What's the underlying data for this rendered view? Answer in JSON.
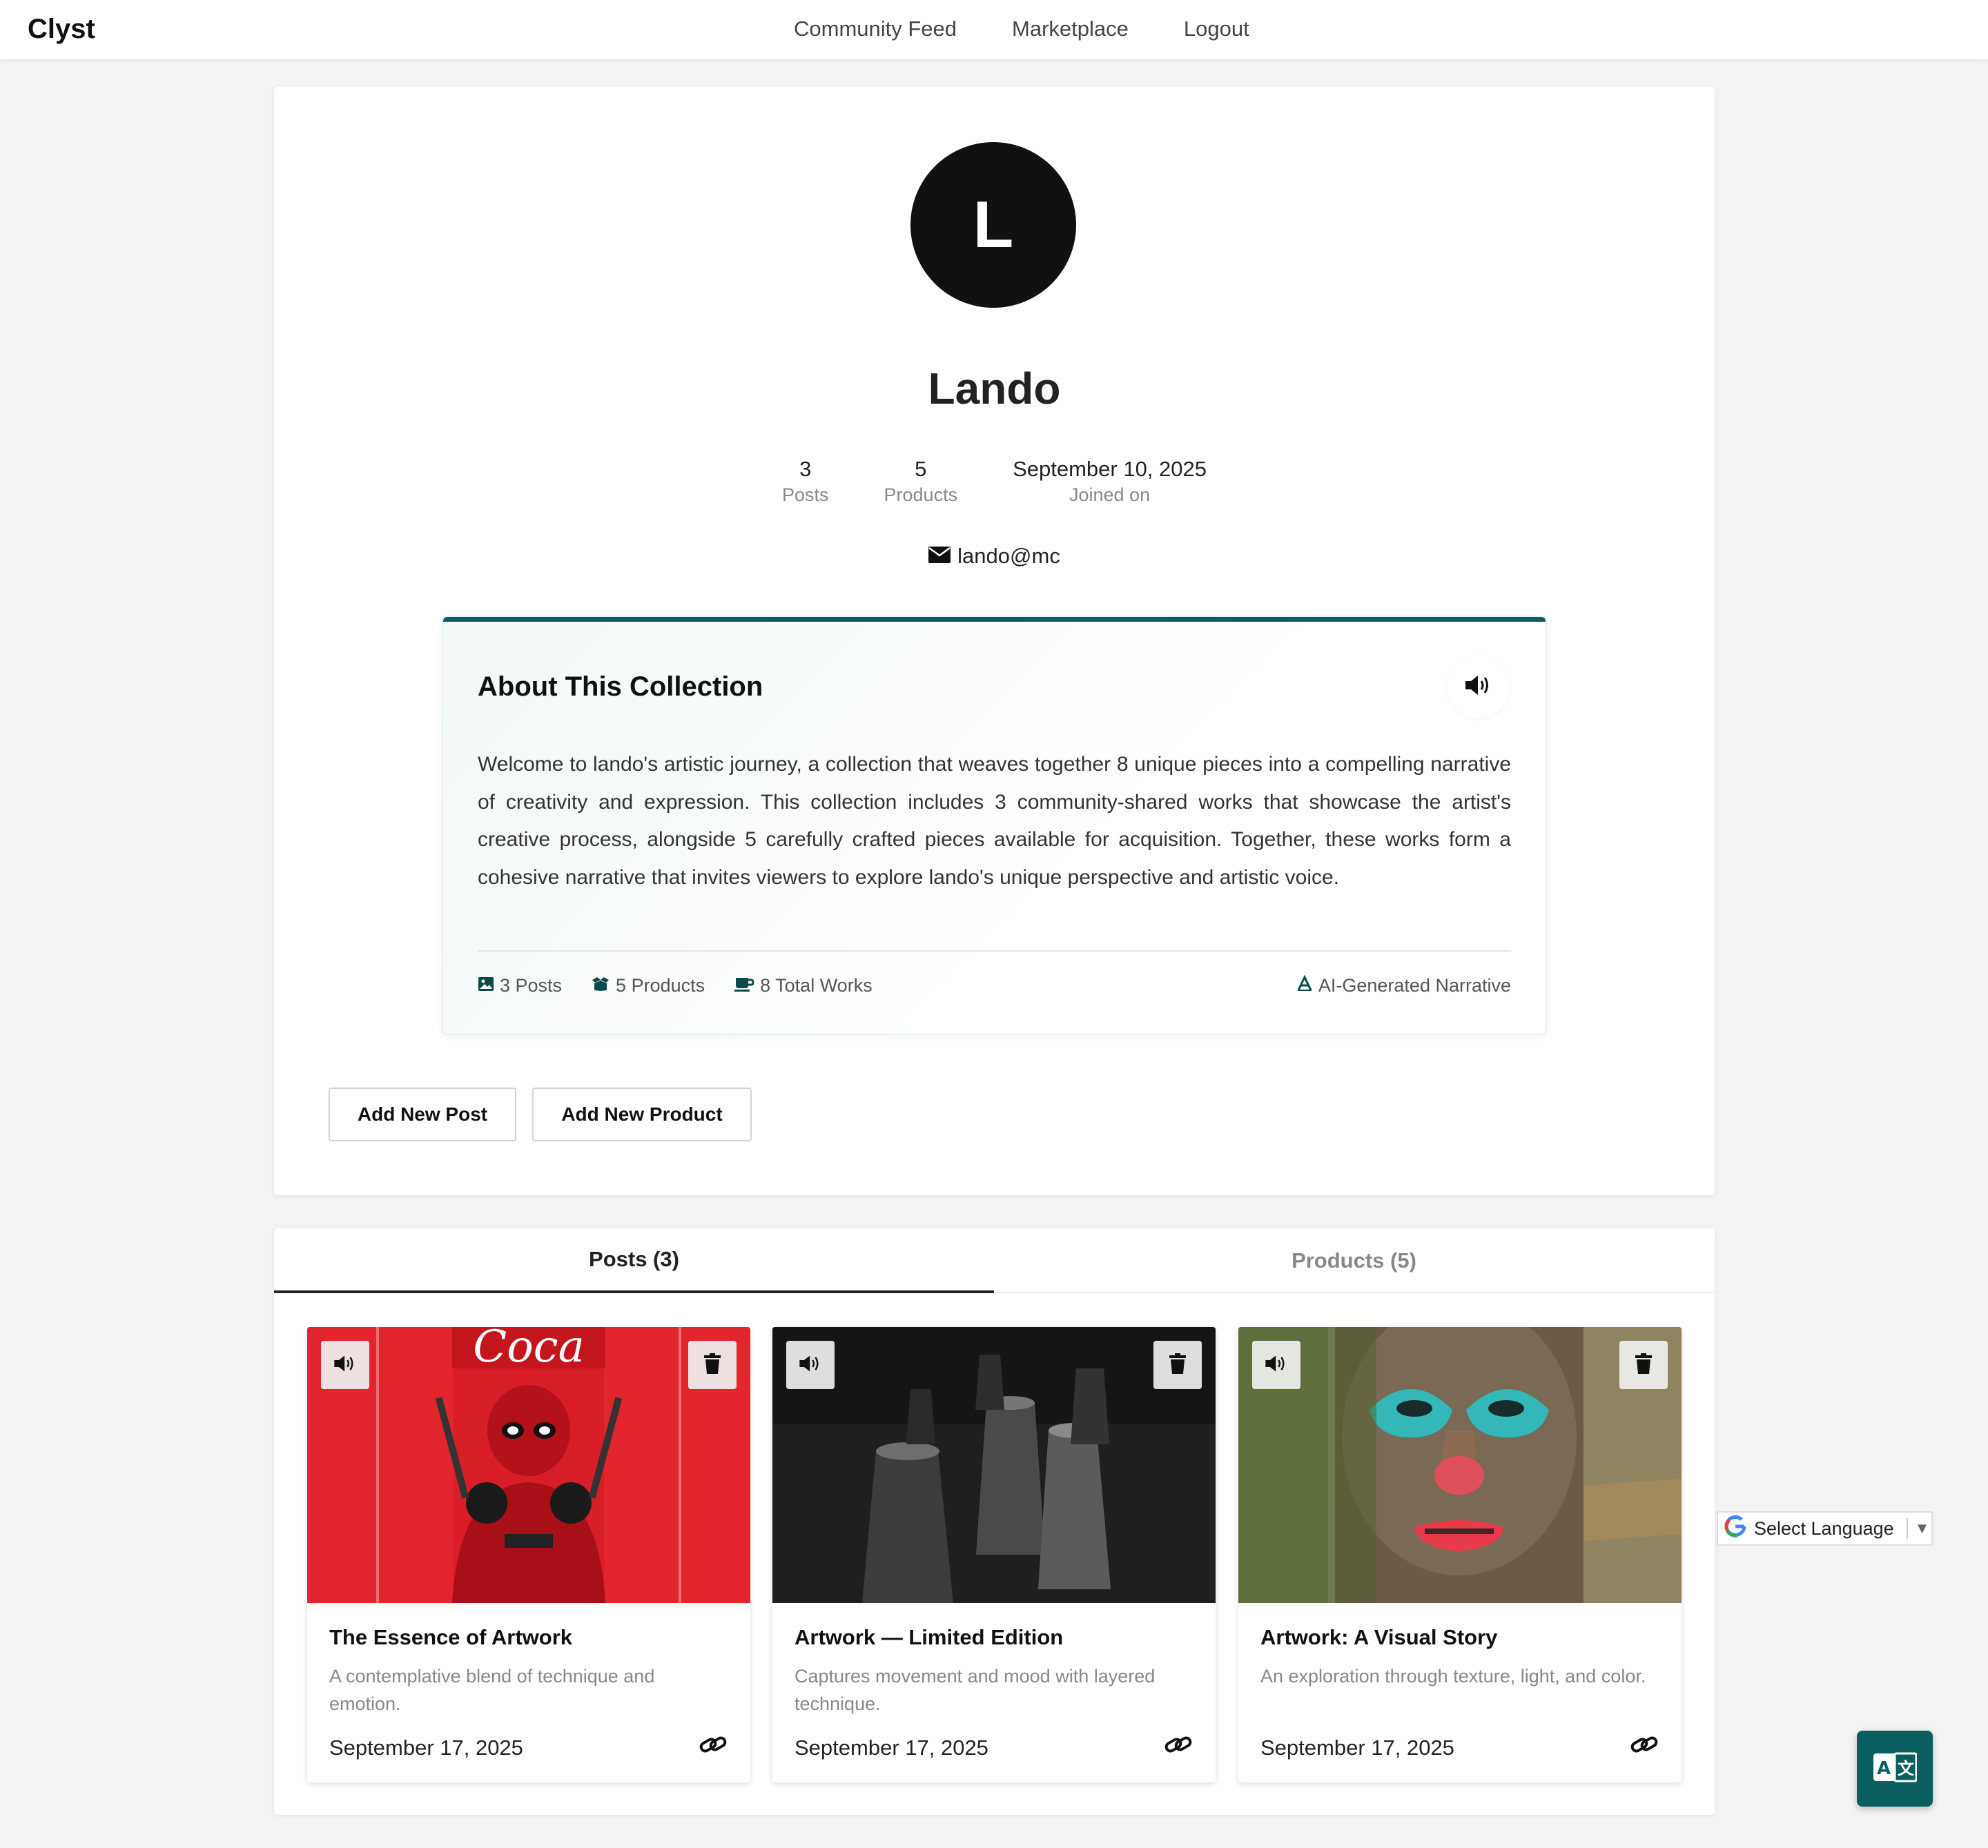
{
  "nav": {
    "brand": "Clyst",
    "links": [
      "Community Feed",
      "Marketplace",
      "Logout"
    ]
  },
  "profile": {
    "avatar_letter": "L",
    "name": "Lando",
    "stats": [
      {
        "value": "3",
        "label": "Posts"
      },
      {
        "value": "5",
        "label": "Products"
      },
      {
        "value": "September 10, 2025",
        "label": "Joined on"
      }
    ],
    "email": "lando@mc"
  },
  "about": {
    "title": "About This Collection",
    "text": "Welcome to lando's artistic journey, a collection that weaves together 8 unique pieces into a compelling narrative of creativity and expression. This collection includes 3 community-shared works that showcase the artist's creative process, alongside 5 carefully crafted pieces available for acquisition. Together, these works form a cohesive narrative that invites viewers to explore lando's unique perspective and artistic voice.",
    "meta": [
      "3 Posts",
      "5 Products",
      "8 Total Works"
    ],
    "ai_label": "AI-Generated Narrative",
    "accent_color": "#0b5e5e"
  },
  "actions": {
    "add_post": "Add New Post",
    "add_product": "Add New Product"
  },
  "tabs": [
    "Posts (3)",
    "Products (5)"
  ],
  "posts": [
    {
      "title": "The Essence of Artwork",
      "description": "A contemplative blend of technique and emotion.",
      "date": "September 17, 2025"
    },
    {
      "title": "Artwork — Limited Edition",
      "description": "Captures movement and mood with layered technique.",
      "date": "September 17, 2025"
    },
    {
      "title": "Artwork: A Visual Story",
      "description": "An exploration through texture, light, and color.",
      "date": "September 17, 2025"
    }
  ],
  "language": {
    "label": "Select Language",
    "arrow": "▼"
  },
  "icons": {
    "audio": "speaker-icon",
    "delete": "trash-icon",
    "link": "link-icon",
    "email": "envelope-icon",
    "translate": "translate-icon"
  }
}
